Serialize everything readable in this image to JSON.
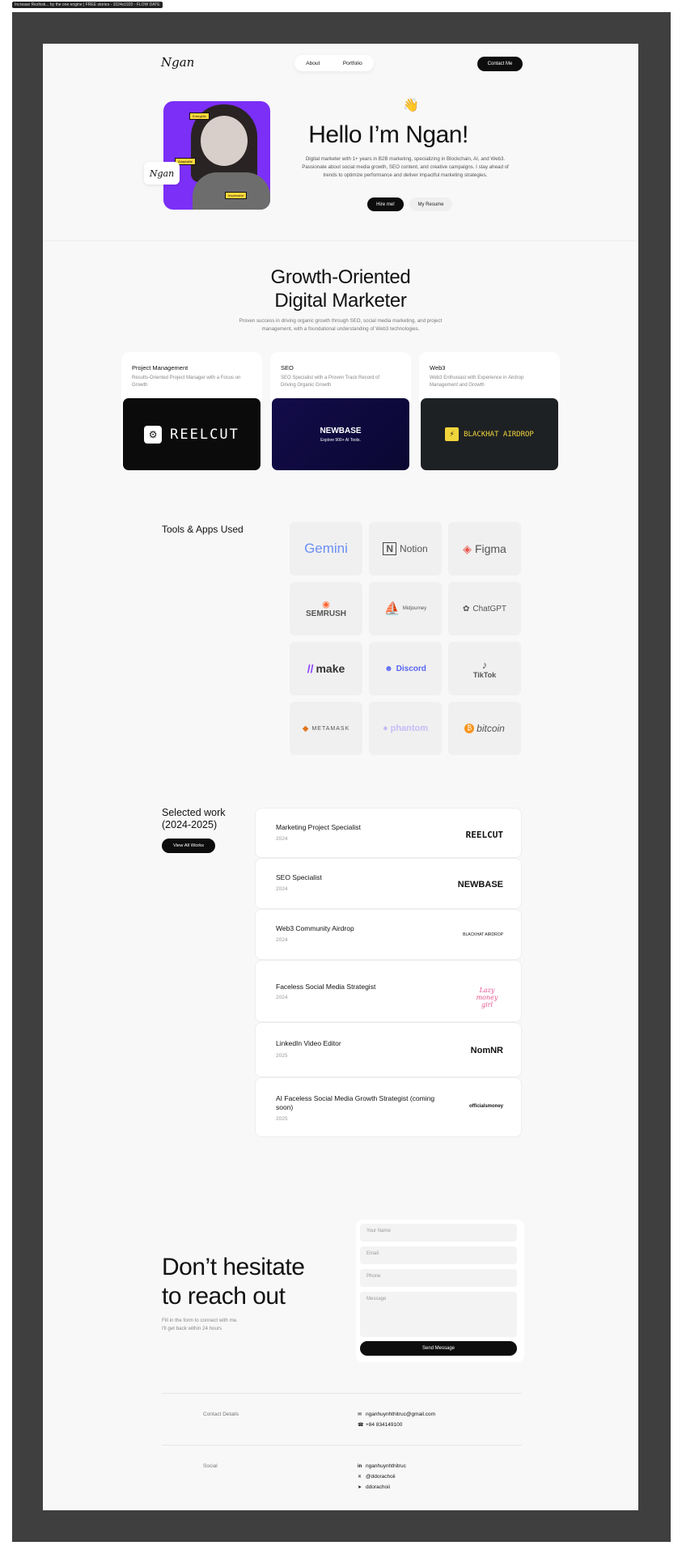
{
  "browser_caption": "Increase Rezhisk... by the one engine | FREE stories - 1024x1920 - FLOW DATE",
  "nav": {
    "logo": "Ngan",
    "links": [
      "About",
      "Portfolio"
    ],
    "contact_label": "Contact Me"
  },
  "hero": {
    "signature": "Ngan",
    "photo_tags": [
      "Energetic",
      "Adaptable",
      "Impressive"
    ],
    "wave": "👋",
    "title": "Hello I’m Ngan!",
    "bio": "Digital marketer with 1+ years in B2B marketing, specializing in Blockchain, AI, and Web3. Passionate about social media growth, SEO content, and creative campaigns. I stay ahead of trends to optimize performance and deliver impactful marketing strategies.",
    "hire_label": "Hire me!",
    "resume_label": "My Resume"
  },
  "growth": {
    "title_line1": "Growth-Oriented",
    "title_line2": "Digital Marketer",
    "subtitle": "Proven success in driving organic growth through SEO, social media marketing, and project management, with a foundational understanding of Web3 technologies.",
    "cards": [
      {
        "title": "Project Management",
        "desc": "Results-Oriented Project Manager with a Focus on Growth",
        "brand": "REELCUT"
      },
      {
        "title": "SEO",
        "desc": "SEO Specialist with a Proven Track Record of Driving Organic Growth",
        "brand": "NEWBASE",
        "brand_sub": "Explore 900+ AI Tools."
      },
      {
        "title": "Web3",
        "desc": "Web3 Enthusiast with Experience in Airdrop Management and Growth",
        "brand": "BLACKHAT AIRDROP"
      }
    ]
  },
  "tools": {
    "label": "Tools & Apps Used",
    "items": [
      "Gemini",
      "Notion",
      "Figma",
      "SEMRUSH",
      "Midjourney",
      "ChatGPT",
      "make",
      "Discord",
      "TikTok",
      "METAMASK",
      "phantom",
      "bitcoin"
    ]
  },
  "works": {
    "title": "Selected work (2024-2025)",
    "view_all": "View All Works",
    "items": [
      {
        "title": "Marketing Project Specialist",
        "year": "2024",
        "logo": "REELCUT"
      },
      {
        "title": "SEO Specialist",
        "year": "2024",
        "logo": "NEWBASE"
      },
      {
        "title": "Web3 Community Airdrop",
        "year": "2024",
        "logo": "BLACKHAT AIRDROP"
      },
      {
        "title": "Faceless Social Media Strategist",
        "year": "2024",
        "logo": "Lazy money girl"
      },
      {
        "title": "LinkedIn Video Editor",
        "year": "2025",
        "logo": "NomNR"
      },
      {
        "title": "AI Faceless Social Media Growth Strategist (coming soon)",
        "year": "2025",
        "logo": "officialsmoney"
      }
    ]
  },
  "contact": {
    "title_line1": "Don’t hesitate",
    "title_line2": "to reach out",
    "subtitle_line1": "Fill in the form to connect with me.",
    "subtitle_line2": "I'll get back within 24 hours",
    "placeholders": {
      "name": "Your Name",
      "email": "Email",
      "phone": "Phone",
      "message": "Message"
    },
    "send_label": "Send Message",
    "details_label": "Contact Details",
    "email": "nganhuynhthitruc@gmail.com",
    "phone": "+84 834149100",
    "social_label": "Social",
    "socials": [
      "nganhuynhthitruc",
      "@ddorachoii",
      "ddorachoii"
    ]
  },
  "colors": {
    "accent_purple": "#7b2ff7",
    "dark": "#0d0d0d",
    "frame": "#3f3f3f"
  }
}
